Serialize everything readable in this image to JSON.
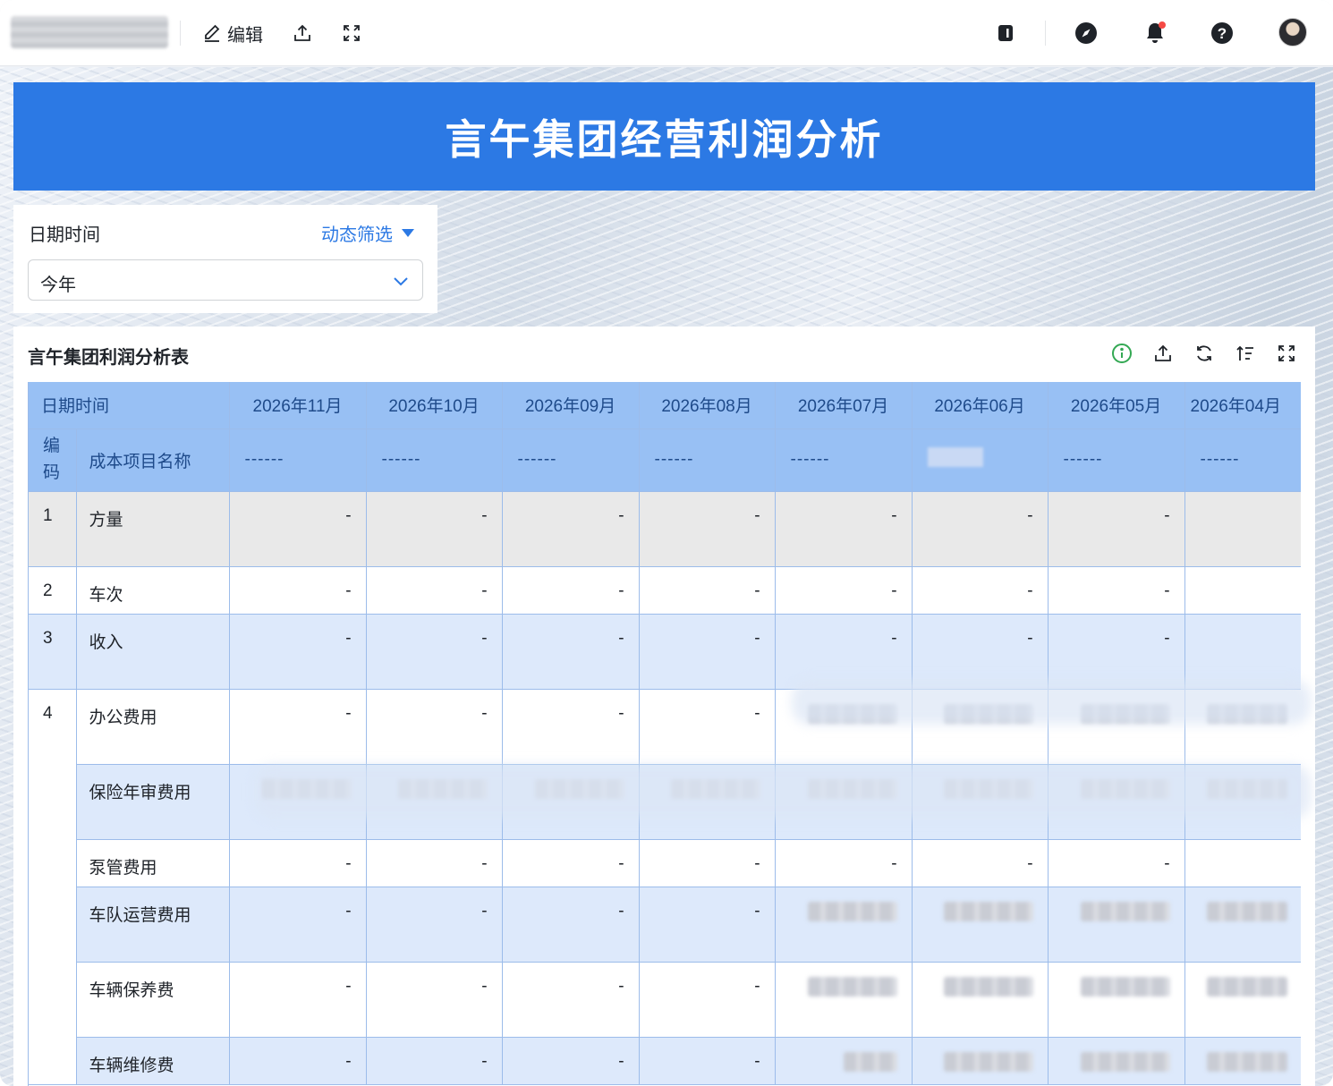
{
  "toolbar": {
    "edit_label": "编辑"
  },
  "dashboard": {
    "title": "言午集团经营利润分析",
    "filter": {
      "label": "日期时间",
      "dynamic_label": "动态筛选",
      "selected": "今年"
    },
    "table_panel": {
      "title": "言午集团利润分析表",
      "header_date_label": "日期时间",
      "col_code": "编码",
      "col_name": "成本项目名称",
      "months": [
        "2026年11月",
        "2026年10月",
        "2026年09月",
        "2026年08月",
        "2026年07月",
        "2026年06月",
        "2026年05月",
        "2026年04月"
      ],
      "dash_row": [
        "------",
        "------",
        "------",
        "------",
        "------",
        "",
        "------",
        "------"
      ],
      "rows": [
        {
          "code": "1",
          "name": "方量",
          "values": [
            "-",
            "-",
            "-",
            "-",
            "-",
            "-",
            "-",
            ""
          ]
        },
        {
          "code": "2",
          "name": "车次",
          "values": [
            "-",
            "-",
            "-",
            "-",
            "-",
            "-",
            "-",
            ""
          ]
        },
        {
          "code": "3",
          "name": "收入",
          "values": [
            "-",
            "-",
            "-",
            "-",
            "-",
            "-",
            "-",
            ""
          ]
        },
        {
          "code": "4",
          "name": "办公费用",
          "values": [
            "-",
            "-",
            "-",
            "-",
            "",
            "",
            "",
            ""
          ]
        },
        {
          "code": "",
          "name": "保险年审费用",
          "values": [
            "",
            "",
            "",
            "",
            "",
            "",
            "",
            ""
          ]
        },
        {
          "code": "",
          "name": "泵管费用",
          "values": [
            "-",
            "-",
            "-",
            "-",
            "-",
            "-",
            "-",
            ""
          ]
        },
        {
          "code": "",
          "name": "车队运营费用",
          "values": [
            "-",
            "-",
            "-",
            "-",
            "",
            "",
            "",
            ""
          ]
        },
        {
          "code": "",
          "name": "车辆保养费",
          "values": [
            "-",
            "-",
            "-",
            "-",
            "",
            "",
            "",
            ""
          ]
        },
        {
          "code": "",
          "name": "车辆维修费",
          "values": [
            "-",
            "-",
            "-",
            "-",
            "",
            "",
            "",
            ""
          ]
        }
      ]
    }
  },
  "colors": {
    "banner": "#2c79e4",
    "header": "#98c0f4",
    "accent": "#2c79e4",
    "info_icon": "#33a853"
  },
  "icons": [
    "edit-icon",
    "export-icon",
    "fullscreen-icon",
    "notebook-icon",
    "compass-icon",
    "bell-icon",
    "help-icon",
    "avatar",
    "info-icon",
    "refresh-icon",
    "sort-icon",
    "chevron-down-icon"
  ]
}
